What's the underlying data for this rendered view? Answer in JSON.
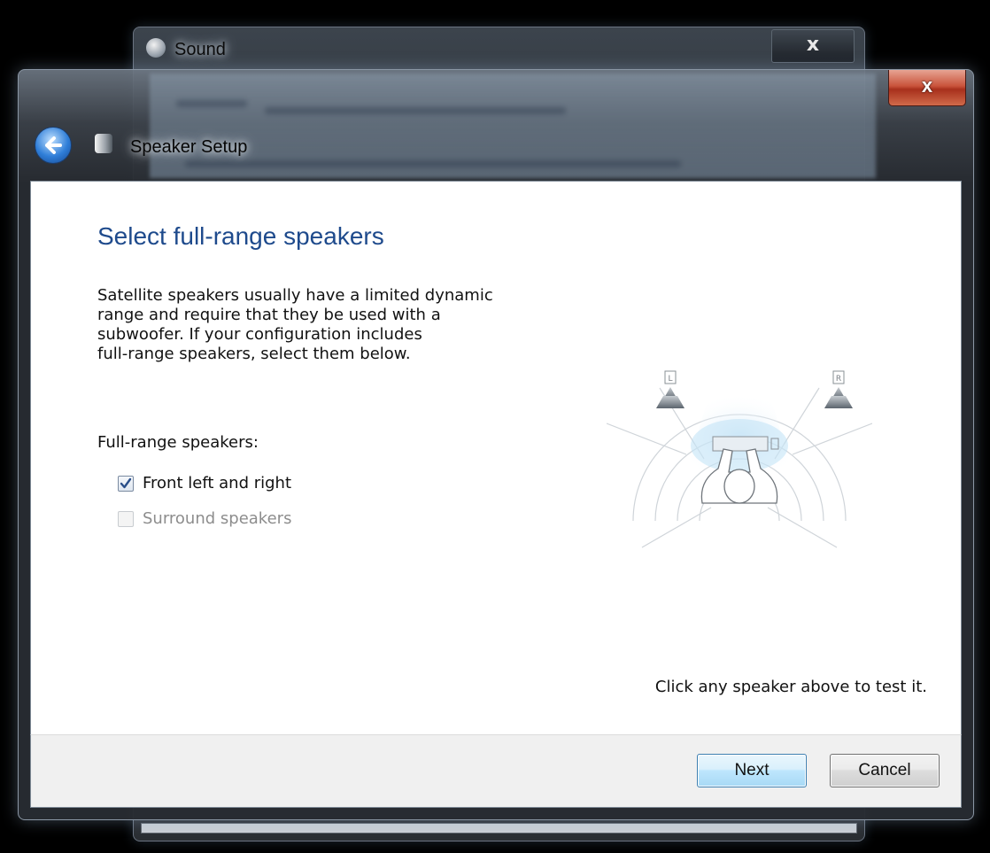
{
  "background_window": {
    "title": "Sound",
    "close_label": "x"
  },
  "dialog": {
    "title": "Speaker Setup",
    "close_label": "x",
    "heading": "Select full-range speakers",
    "description": [
      "Satellite speakers usually have a limited dynamic",
      "range and require that they be used with a",
      "subwoofer.  If your configuration includes",
      "full-range speakers, select them below."
    ],
    "group_label": "Full-range speakers:",
    "options": [
      {
        "label": "Front left and right",
        "checked": true,
        "enabled": true
      },
      {
        "label": "Surround speakers",
        "checked": false,
        "enabled": false
      }
    ],
    "diagram": {
      "left_speaker_label": "L",
      "right_speaker_label": "R"
    },
    "hint": "Click any speaker above to test it.",
    "buttons": {
      "next": "Next",
      "cancel": "Cancel"
    }
  },
  "icons": {
    "back": "back-arrow-icon",
    "speaker": "speaker-icon",
    "checkmark": "checkmark-icon"
  },
  "colors": {
    "heading": "#1e4a8c",
    "close_button": "#c9543c",
    "next_button": "#bee6fd"
  }
}
